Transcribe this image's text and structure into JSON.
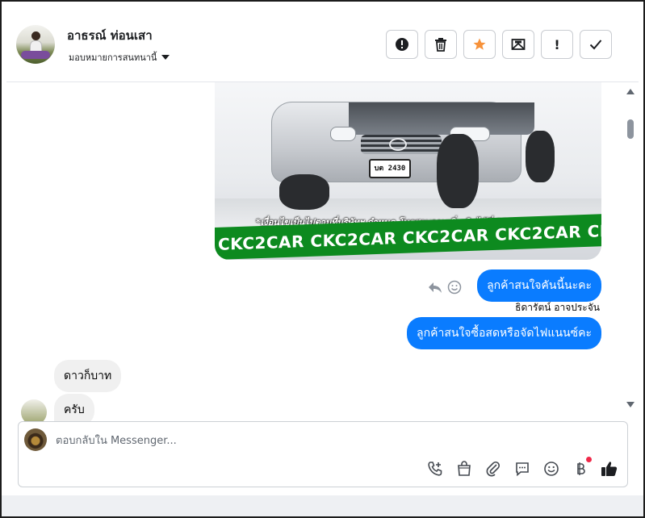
{
  "header": {
    "contact_name": "อาธรณ์ ท่อนเสา",
    "assign_label": "มอบหมายการสนทนานี้",
    "toolbar": [
      {
        "name": "spam-button",
        "icon": "alert-circle-icon",
        "glyph": "!"
      },
      {
        "name": "delete-button",
        "icon": "trash-icon",
        "glyph": ""
      },
      {
        "name": "star-button",
        "icon": "star-icon",
        "glyph": "",
        "color": "#f7923a"
      },
      {
        "name": "mark-unread-button",
        "icon": "envelope-icon",
        "glyph": ""
      },
      {
        "name": "follow-up-button",
        "icon": "exclamation-icon",
        "glyph": "!"
      },
      {
        "name": "done-button",
        "icon": "check-icon",
        "glyph": ""
      }
    ]
  },
  "conversation": {
    "image": {
      "plate": "บต 2430",
      "caption": "*เงื่อนไขเป็นไปตามที่บริษัทฯ กำหนด โทรสอบถามเพิ่มเติมได้ที่ 088-5577932",
      "banner": "CKC2CAR CKC2CAR CKC2CAR CKC2CAR CKC2"
    },
    "messages": [
      {
        "direction": "out",
        "text": "ลูกค้าสนใจคันนี้นะคะ"
      },
      {
        "direction": "out",
        "text": "ลูกค้าสนใจซื้อสดหรือจัดไฟแนนซ์คะ"
      },
      {
        "direction": "in",
        "text": "ดาวก็บาท"
      },
      {
        "direction": "in",
        "text": "ครับ"
      }
    ],
    "sender_name": "ธิดารัตน์ อาจประจัน"
  },
  "composer": {
    "placeholder": "ตอบกลับใน Messenger...",
    "tools": [
      "call-icon",
      "shopping-bag-icon",
      "paperclip-icon",
      "comment-icon",
      "emoji-icon",
      "baht-icon",
      "thumbs-up-icon"
    ]
  },
  "colors": {
    "outgoing_bubble": "#0a7cff",
    "incoming_bubble": "#f0f0f0",
    "star": "#f7923a",
    "notification_dot": "#f02849",
    "banner_green": "#0d8a1f"
  }
}
